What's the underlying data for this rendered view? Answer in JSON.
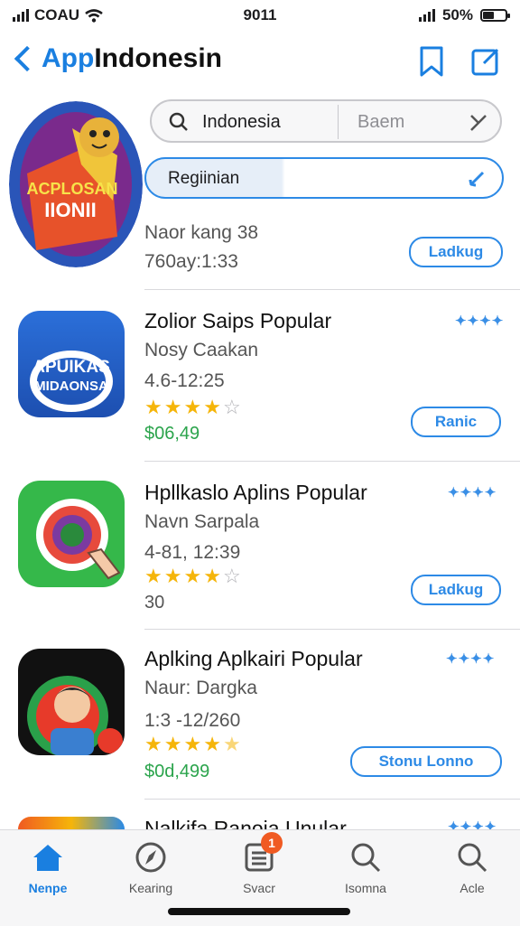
{
  "status": {
    "carrier": "COAU",
    "time": "9011",
    "battery": "50%",
    "battery_level": 0.5
  },
  "nav": {
    "back_label": "App",
    "title": "Indonesin"
  },
  "search": {
    "query": "Indonesia",
    "scope": "Baem"
  },
  "region": {
    "label": "Regiinian"
  },
  "featured": {
    "icon_text_line1": "ACPLOSAN",
    "icon_text_line2": "IIONII",
    "subtitle": "Naor kang 38",
    "meta": "760ay:1:33",
    "button": "Ladkug"
  },
  "apps": [
    {
      "name": "Zolior Saips Popular",
      "developer": "Nosy Caakan",
      "meta": "4.6-12:25",
      "rating": 4,
      "price": "$06,49",
      "price_green": true,
      "button": "Ranic",
      "icon_line1": "APUIKAS",
      "icon_line2": "MIDAONSA"
    },
    {
      "name": "Hpllkaslo Aplins Popular",
      "developer": "Navn Sarpala",
      "meta": "4-81, 12:39",
      "rating": 4,
      "price": "30",
      "price_green": false,
      "button": "Ladkug"
    },
    {
      "name": "Aplking Aplkairi Popular",
      "developer": "Naur: Dargka",
      "meta": "1:3 -12/260",
      "rating": 4.5,
      "price": "$0d,499",
      "price_green": true,
      "button": "Stonu Lonno"
    },
    {
      "name": "Nalkifa Ranoia Unular"
    }
  ],
  "more_dots": "✦✦✦✦",
  "tabs": [
    {
      "label": "Nenpe",
      "icon": "home-icon"
    },
    {
      "label": "Kearing",
      "icon": "compass-icon"
    },
    {
      "label": "Svacr",
      "icon": "list-icon",
      "badge": "1"
    },
    {
      "label": "Isomna",
      "icon": "search-icon"
    },
    {
      "label": "Acle",
      "icon": "search-icon"
    }
  ],
  "colors": {
    "accent": "#1a7fe0",
    "star": "#f5b50a",
    "price": "#2ba44c",
    "badge": "#f05a22"
  }
}
